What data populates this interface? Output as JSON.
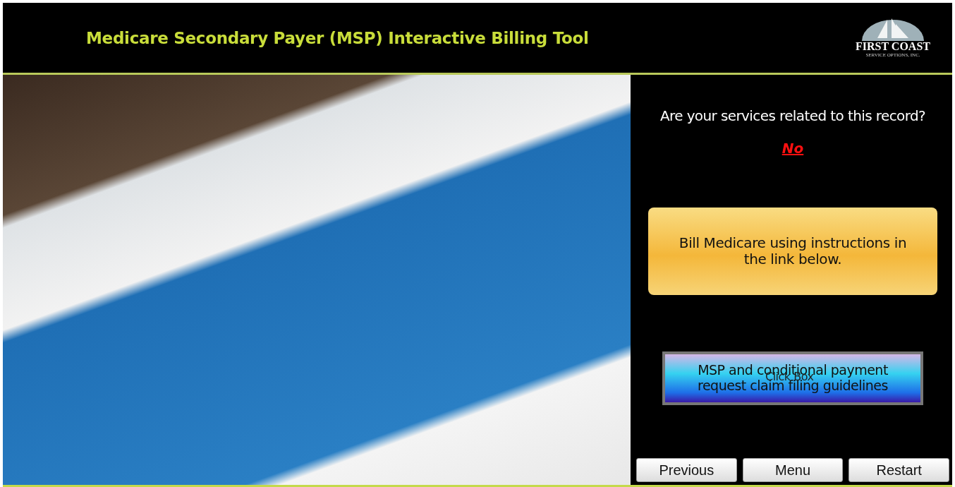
{
  "header": {
    "title": "Medicare Secondary Payer (MSP) Interactive Billing Tool",
    "logo": {
      "name": "FIRST COAST",
      "tagline": "SERVICE OPTIONS, INC."
    }
  },
  "panel": {
    "question": "Are your services related to this record?",
    "answer": "No",
    "result": "Bill Medicare using instructions in the link below.",
    "link": {
      "label": "MSP and conditional payment request claim filing guidelines",
      "overlay": "Click Box"
    }
  },
  "nav_buttons": [
    "Previous",
    "Menu",
    "Restart"
  ]
}
